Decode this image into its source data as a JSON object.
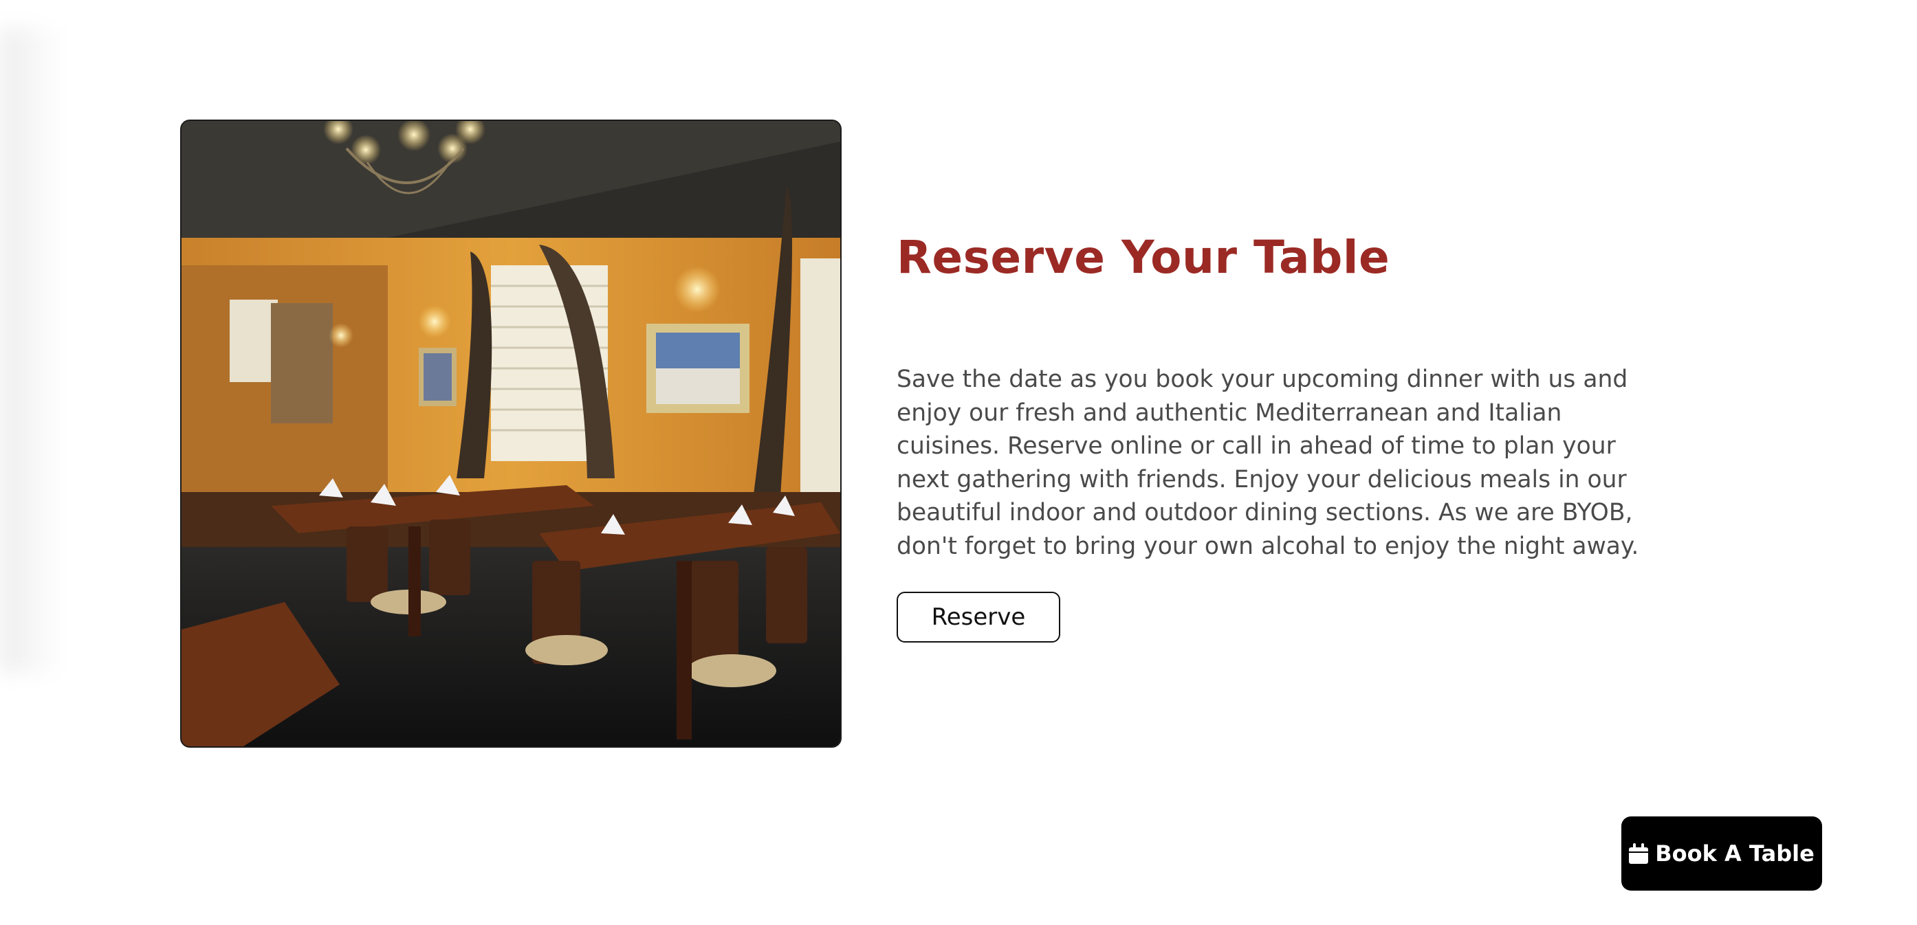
{
  "section": {
    "heading": "Reserve Your Table",
    "description": "Save the date as you book your upcoming dinner with us and enjoy our fresh and authentic Mediterranean and Italian cuisines. Reserve online or call in ahead of time to plan your next gathering with friends. Enjoy your delicious meals in our beautiful indoor and outdoor dining sections. As we are BYOB, don't forget to bring your own alcohal to enjoy the night away.",
    "reserve_label": "Reserve"
  },
  "floating_cta": {
    "label": "Book A Table",
    "icon": "calendar-icon"
  },
  "colors": {
    "heading": "#9b2a25",
    "body_text": "#4a4a4a",
    "cta_background": "#000000"
  }
}
